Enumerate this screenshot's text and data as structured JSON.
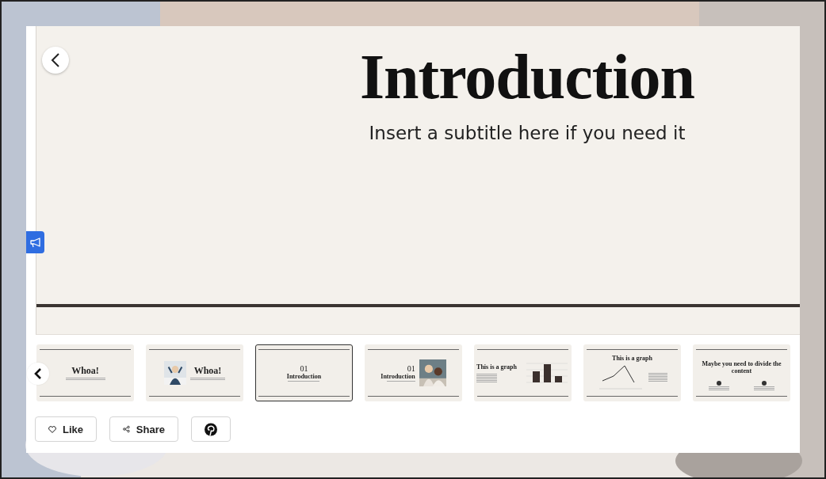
{
  "slide": {
    "title": "Introduction",
    "subtitle": "Insert a subtitle here if you need it"
  },
  "thumbnails": [
    {
      "kind": "title",
      "title": "Whoa!",
      "selected": false
    },
    {
      "kind": "photo-title",
      "title": "Whoa!",
      "selected": false
    },
    {
      "kind": "section",
      "number": "01",
      "title": "Introduction",
      "selected": true
    },
    {
      "kind": "section-photo",
      "number": "01",
      "title": "Introduction",
      "selected": false
    },
    {
      "kind": "bar-graph",
      "title": "This is a graph",
      "selected": false
    },
    {
      "kind": "line-graph",
      "title": "This is a graph",
      "selected": false
    },
    {
      "kind": "two-columns",
      "title": "Maybe you need to divide the content",
      "selected": false
    }
  ],
  "actions": [
    {
      "kind": "like",
      "label": "Like"
    },
    {
      "kind": "share",
      "label": "Share"
    },
    {
      "kind": "pinterest"
    }
  ]
}
